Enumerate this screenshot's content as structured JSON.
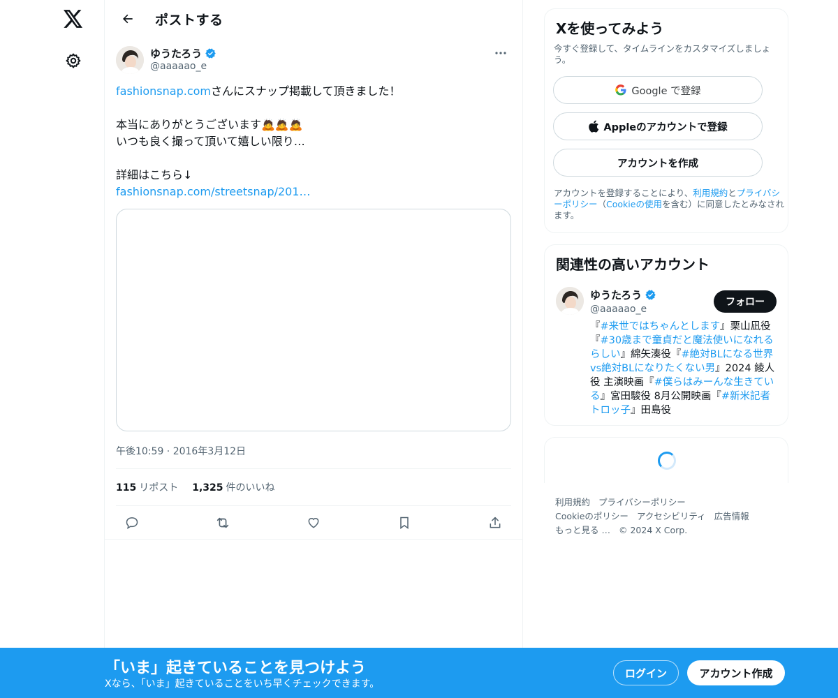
{
  "header": {
    "title": "ポストする"
  },
  "tweet": {
    "author_name": "ゆうたろう",
    "author_handle": "@aaaaao_e",
    "link1": "fashionsnap.com",
    "line1_rest": "さんにスナップ掲載して頂きました！",
    "line2": "本当にありがとうございます🙇🙇🙇",
    "line3": "いつも良く撮って頂いて嬉しい限り…",
    "line4": "詳細はこちら↓",
    "link2": "fashionsnap.com/streetsnap/201…",
    "timestamp": "午後10:59 · 2016年3月12日",
    "reposts_count": "115",
    "reposts_label": "リポスト",
    "likes_count": "1,325",
    "likes_label": "件のいいね"
  },
  "signup": {
    "title": "Xを使ってみよう",
    "subtitle": "今すぐ登録して、タイムラインをカスタマイズしましょう。",
    "google_label": "Google で登録",
    "apple_label": "Appleのアカウントで登録",
    "create_label": "アカウントを作成",
    "terms_1": "アカウントを登録することにより、",
    "terms_link1": "利用規約",
    "terms_2": "と",
    "terms_link2": "プライバシーポリシー",
    "terms_3": "（",
    "terms_link3": "Cookieの使用",
    "terms_4": "を含む）に同意したとみなされます。"
  },
  "related": {
    "title": "関連性の高いアカウント",
    "name": "ゆうたろう",
    "handle": "@aaaaao_e",
    "follow_label": "フォロー",
    "bio": [
      {
        "t": "『",
        "link": false
      },
      {
        "t": "#来世ではちゃんとします",
        "link": true
      },
      {
        "t": "』栗山凪役 『",
        "link": false
      },
      {
        "t": "#30歳まで童貞だと魔法使いになれるらしい",
        "link": true
      },
      {
        "t": "』綿矢湊役『",
        "link": false
      },
      {
        "t": "#絶対BLになる世界vs絶対BLになりたくない男",
        "link": true
      },
      {
        "t": "』2024 綾人役 主演映画『",
        "link": false
      },
      {
        "t": "#僕らはみーんな生きている",
        "link": true
      },
      {
        "t": "』宮田駿役 8月公開映画『",
        "link": false
      },
      {
        "t": "#新米記者トロッ子",
        "link": true
      },
      {
        "t": "』田島役",
        "link": false
      }
    ]
  },
  "footer": {
    "terms": "利用規約",
    "privacy": "プライバシーポリシー",
    "cookie": "Cookieのポリシー",
    "accessibility": "アクセシビリティ",
    "ads": "広告情報",
    "more": "もっと見る …",
    "copyright": "© 2024 X Corp."
  },
  "bottom_bar": {
    "title": "「いま」起きていることを見つけよう",
    "subtitle": "Xなら、「いま」起きていることをいち早くチェックできます。",
    "login_label": "ログイン",
    "signup_label": "アカウント作成"
  },
  "colors": {
    "accent": "#1d9bf0",
    "text": "#0f1419",
    "muted": "#536471",
    "border": "#eff3f4"
  },
  "icons": [
    "x-logo-icon",
    "gear-icon",
    "back-arrow-icon",
    "verified-badge-icon",
    "more-icon",
    "reply-icon",
    "repost-icon",
    "like-icon",
    "bookmark-icon",
    "share-icon",
    "google-icon",
    "apple-icon",
    "loading-spinner"
  ]
}
